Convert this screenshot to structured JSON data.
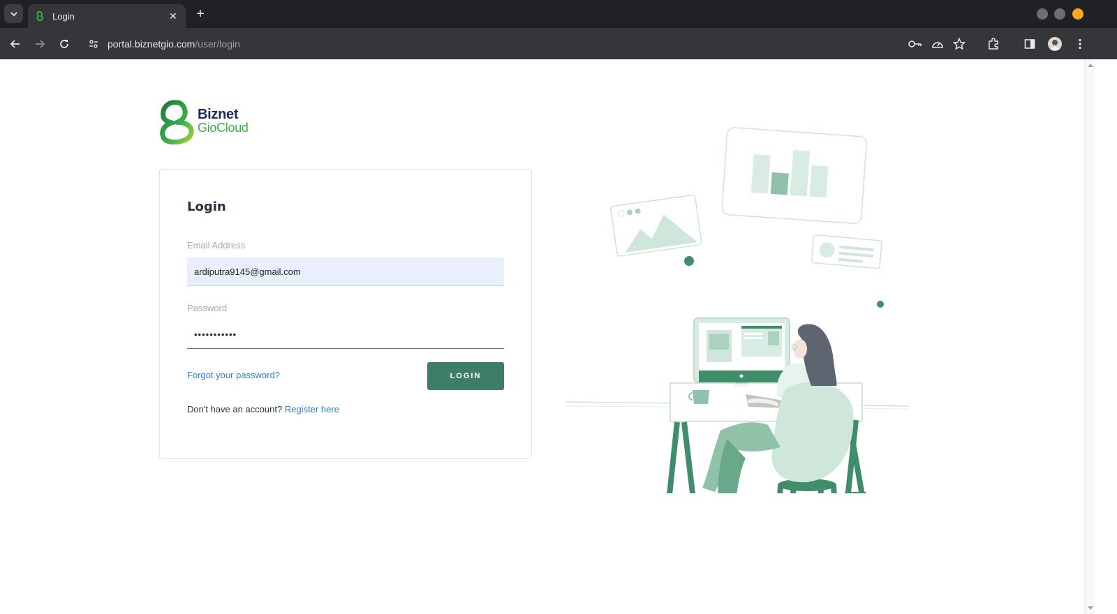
{
  "browser": {
    "tab_title": "Login",
    "url_host": "portal.biznetgio.com",
    "url_path": "/user/login",
    "colors": {
      "chrome_dark": "#202124",
      "toolbar": "#35363a",
      "close_dot": "#f9a825"
    }
  },
  "brand": {
    "line1": "Biznet",
    "line2": "GioCloud",
    "colors": {
      "primary": "#1d2b5a",
      "secondary": "#3fae49"
    }
  },
  "login_form": {
    "title": "Login",
    "email_label": "Email Address",
    "email_value": "ardiputra9145@gmail.com",
    "password_label": "Password",
    "password_value": "•••••••••••",
    "forgot_link": "Forgot your password?",
    "login_button": "LOGIN",
    "register_prompt": "Don't have an account?",
    "register_link": "Register here",
    "colors": {
      "button": "#3f7e66",
      "link": "#2f7fd6",
      "input_autofill": "#e8f0fe"
    }
  },
  "icons": {
    "tab_dropdown": "chevron-down-icon",
    "back": "arrow-left-icon",
    "forward": "arrow-right-icon",
    "reload": "reload-icon",
    "site_info": "tune-icon",
    "password_key": "key-icon",
    "performance": "gauge-icon",
    "bookmark": "star-icon",
    "extensions": "puzzle-icon",
    "side_panel": "side-panel-icon",
    "profile": "avatar",
    "menu": "more-vert-icon"
  }
}
